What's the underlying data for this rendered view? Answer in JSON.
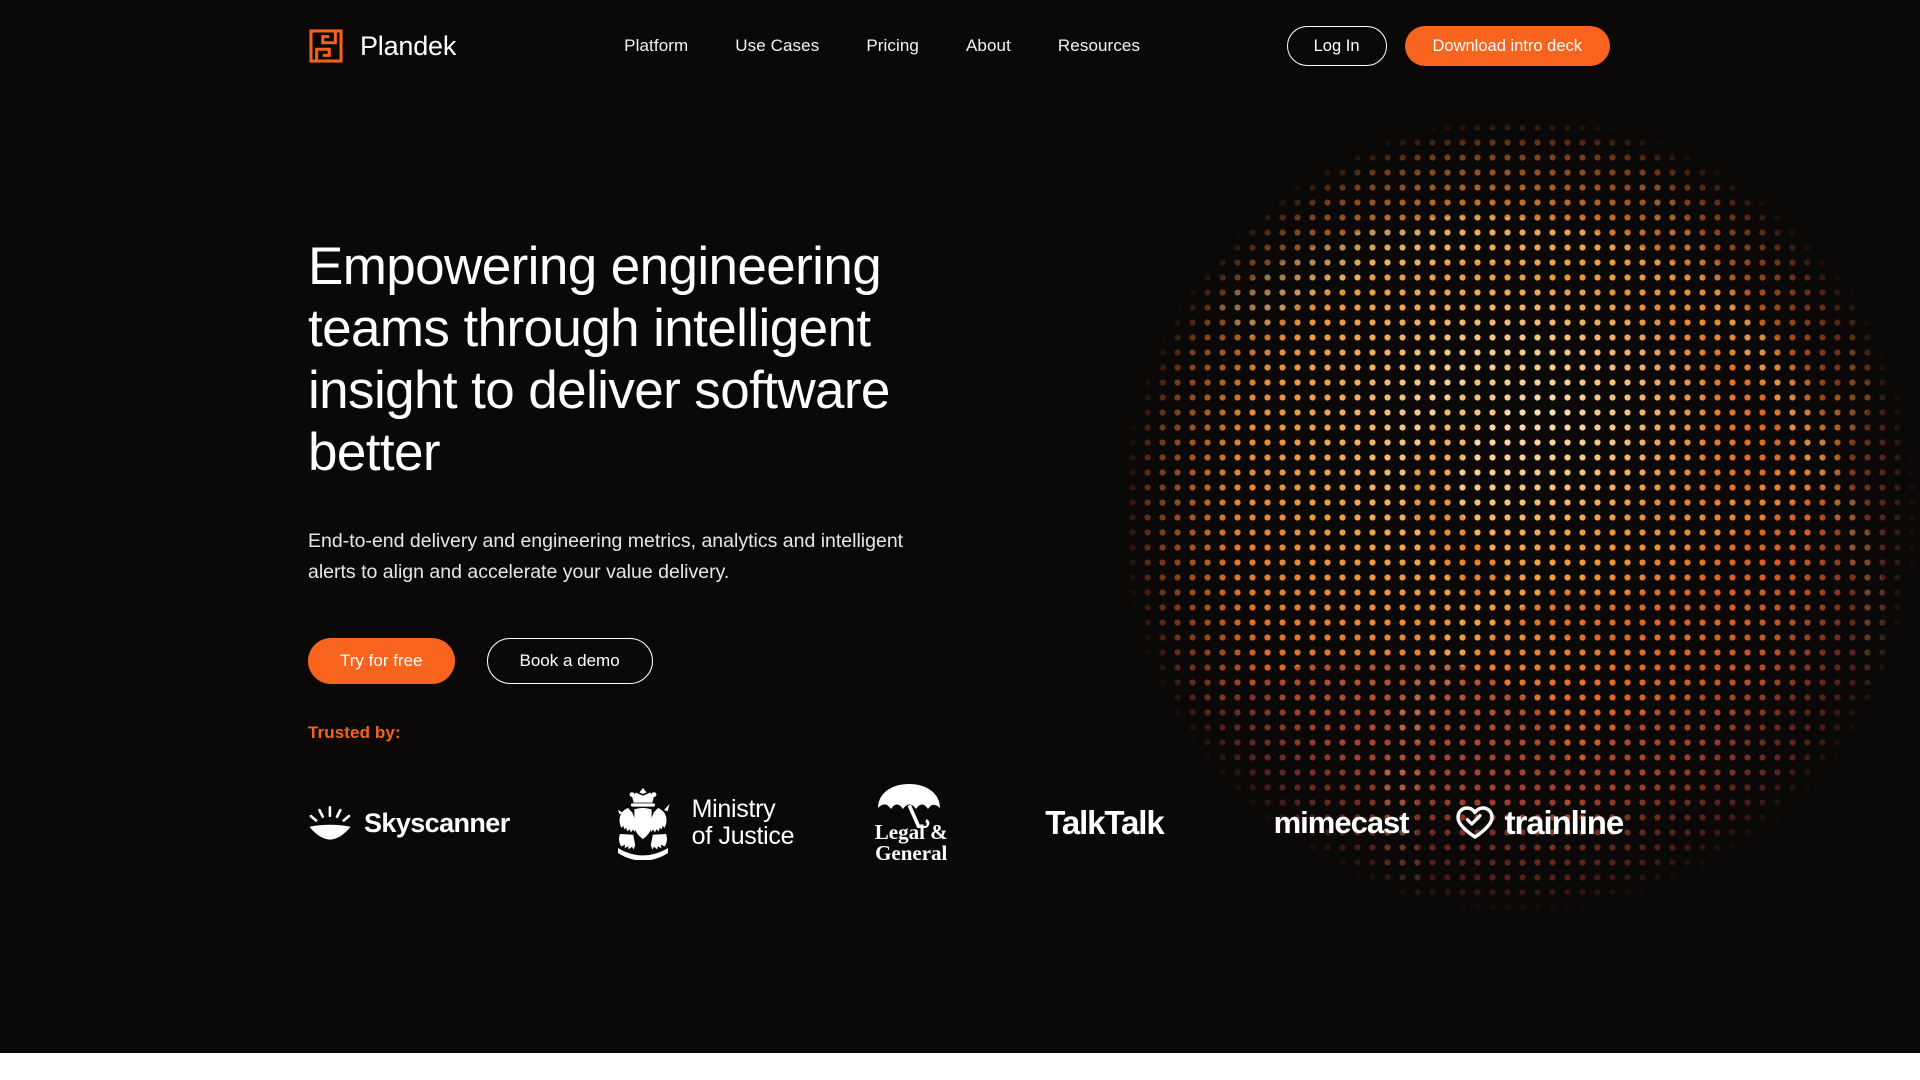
{
  "theme": {
    "background": "#0a0908",
    "accent": "#f8631d",
    "text": "#ffffff",
    "muted_text": "#e9e7e5",
    "page_background": "#ffffff"
  },
  "header": {
    "brand": {
      "name": "Plandek",
      "logo_icon": "plandek-maze-mark"
    },
    "nav": [
      {
        "label": "Platform"
      },
      {
        "label": "Use Cases"
      },
      {
        "label": "Pricing"
      },
      {
        "label": "About"
      },
      {
        "label": "Resources"
      }
    ],
    "actions": {
      "login_label": "Log In",
      "download_label": "Download intro deck"
    }
  },
  "hero": {
    "title": "Empowering engineering teams through intelligent insight to deliver software better",
    "subtitle": "End-to-end delivery and engineering metrics, analytics and intelligent alerts to align and accelerate your value delivery.",
    "primary_cta": "Try for free",
    "secondary_cta": "Book a demo",
    "artwork": "dotted-sphere-orb"
  },
  "trusted": {
    "label": "Trusted by:",
    "logos": [
      {
        "name": "Skyscanner",
        "icon": "sunburst-icon"
      },
      {
        "name_line1": "Ministry",
        "name_line2": "of Justice",
        "icon": "royal-crest-icon"
      },
      {
        "name_line1": "Legal &",
        "name_line2": "General",
        "icon": "umbrella-icon"
      },
      {
        "name": "TalkTalk"
      },
      {
        "name": "mimecast"
      },
      {
        "name": "trainline",
        "icon": "heart-icon"
      }
    ]
  }
}
